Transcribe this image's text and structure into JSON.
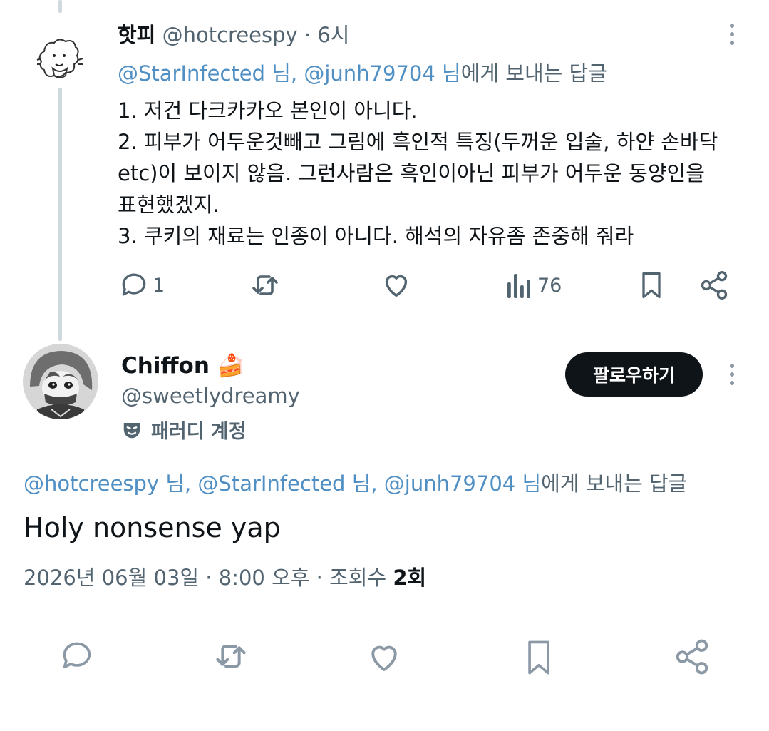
{
  "reply_tweet": {
    "display_name": "핫피",
    "handle": "@hotcreespy",
    "separator": "·",
    "time": "6시",
    "reply_to": {
      "mentions": "@StarInfected 님, @junh79704 님",
      "suffix": "에게 보내는 답글"
    },
    "lines": [
      "1. 저건 다크카카오 본인이 아니다.",
      "2. 피부가 어두운것빼고 그림에 흑인적 특징(두꺼운 입술, 하얀 손바닥",
      "etc)이 보이지 않음. 그런사람은 흑인이아닌 피부가 어두운 동양인을",
      "표현했겠지.",
      "3. 쿠키의 재료는 인종이 아니다. 해석의 자유좀 존중해 줘라"
    ],
    "actions": {
      "reply_count": "1",
      "views_count": "76"
    },
    "icons": [
      "reply-icon",
      "retweet-icon",
      "like-icon",
      "views-icon",
      "bookmark-icon",
      "share-icon",
      "more-icon"
    ]
  },
  "main_tweet": {
    "display_name": "Chiffon",
    "name_emoji": "🍰",
    "handle": "@sweetlydreamy",
    "parody_label": "패러디 계정",
    "follow_label": "팔로우하기",
    "reply_to": {
      "mentions": "@hotcreespy 님, @StarInfected 님, @junh79704 님",
      "suffix": "에게 보내는 답글"
    },
    "text": "Holy nonsense yap",
    "date": "2026년 06월 03일 · 8:00 오후 · 조회수 ",
    "views": "2회",
    "icons": [
      "reply-icon",
      "retweet-icon",
      "like-icon",
      "bookmark-icon",
      "share-icon",
      "mask-icon",
      "more-icon"
    ]
  },
  "colors": {
    "text": "#0f1419",
    "muted": "#536471",
    "mention": "#4f8fc4",
    "thread_line": "#cfd9de",
    "follow_bg": "#0f1419"
  }
}
